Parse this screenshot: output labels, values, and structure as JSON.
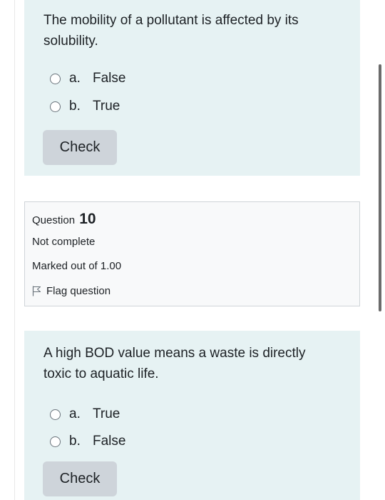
{
  "question9": {
    "text": "The mobility of a pollutant is affected by its solubility.",
    "answers": [
      {
        "letter": "a.",
        "label": "False"
      },
      {
        "letter": "b.",
        "label": "True"
      }
    ],
    "check_label": "Check"
  },
  "question10_info": {
    "prefix": "Question",
    "number": "10",
    "state": "Not complete",
    "grade": "Marked out of 1.00",
    "flag_label": "Flag question",
    "flag_icon": "flag-outline-icon"
  },
  "question10": {
    "text": "A high BOD value means a waste is directly toxic to aquatic life.",
    "answers": [
      {
        "letter": "a.",
        "label": "True"
      },
      {
        "letter": "b.",
        "label": "False"
      }
    ],
    "check_label": "Check"
  },
  "colors": {
    "formulation_bg": "#e6f2f3",
    "info_bg": "#f8f9fa",
    "button_bg": "#ced4da",
    "text": "#1d2125"
  }
}
